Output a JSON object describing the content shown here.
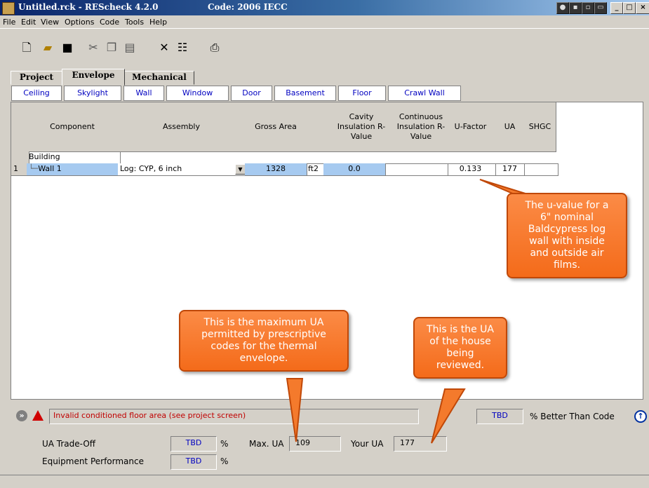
{
  "window": {
    "title": "Untitled.rck - REScheck 4.2.0",
    "code": "Code: 2006 IECC"
  },
  "menu": [
    "File",
    "Edit",
    "View",
    "Options",
    "Code",
    "Tools",
    "Help"
  ],
  "toolbar": {
    "icons": [
      "new-file-icon",
      "open-folder-icon",
      "save-icon",
      "cut-icon",
      "copy-icon",
      "paste-icon",
      "delete-icon",
      "add-row-icon",
      "print-icon"
    ]
  },
  "tabs": [
    "Project",
    "Envelope",
    "Mechanical"
  ],
  "active_tab": "Envelope",
  "subtabs": [
    "Ceiling",
    "Skylight",
    "Wall",
    "Window",
    "Door",
    "Basement",
    "Floor",
    "Crawl Wall"
  ],
  "grid": {
    "headers": {
      "component": "Component",
      "assembly": "Assembly",
      "gross_area": "Gross Area",
      "cavity": "Cavity Insulation R-Value",
      "continuous": "Continuous Insulation R-Value",
      "ufactor": "U-Factor",
      "ua": "UA",
      "shgc": "SHGC"
    },
    "group_row": {
      "label": "Building"
    },
    "row": {
      "index": "1",
      "component": "Wall 1",
      "assembly": "Log: CYP, 6 inch",
      "gross_area": "1328",
      "unit": "ft2",
      "cavity": "0.0",
      "continuous": "",
      "ufactor": "0.133",
      "ua": "177",
      "shgc": ""
    }
  },
  "status": {
    "message": "Invalid conditioned floor area (see project screen)",
    "better_value": "TBD",
    "better_label": "% Better Than Code"
  },
  "bottom": {
    "ua_tradeoff_label": "UA Trade-Off",
    "ua_tradeoff_value": "TBD",
    "equipment_label": "Equipment Performance",
    "equipment_value": "TBD",
    "percent": "%",
    "max_ua_label": "Max. UA",
    "max_ua_value": "109",
    "your_ua_label": "Your UA",
    "your_ua_value": "177"
  },
  "callouts": {
    "ufactor_note": [
      "The u-value for a",
      "6\" nominal",
      "Baldcypress log",
      "wall with inside",
      "and outside air",
      "films."
    ],
    "max_ua_note": [
      "This is the maximum UA",
      "permitted by prescriptive",
      "codes for the thermal",
      "envelope."
    ],
    "your_ua_note": [
      "This is the UA",
      "of the house",
      "being",
      "reviewed."
    ]
  },
  "colors": {
    "titlebar": "#0a246a",
    "selected_row": "#a6caf0",
    "link_text": "#0000c0",
    "callout": "#f47a2c"
  }
}
